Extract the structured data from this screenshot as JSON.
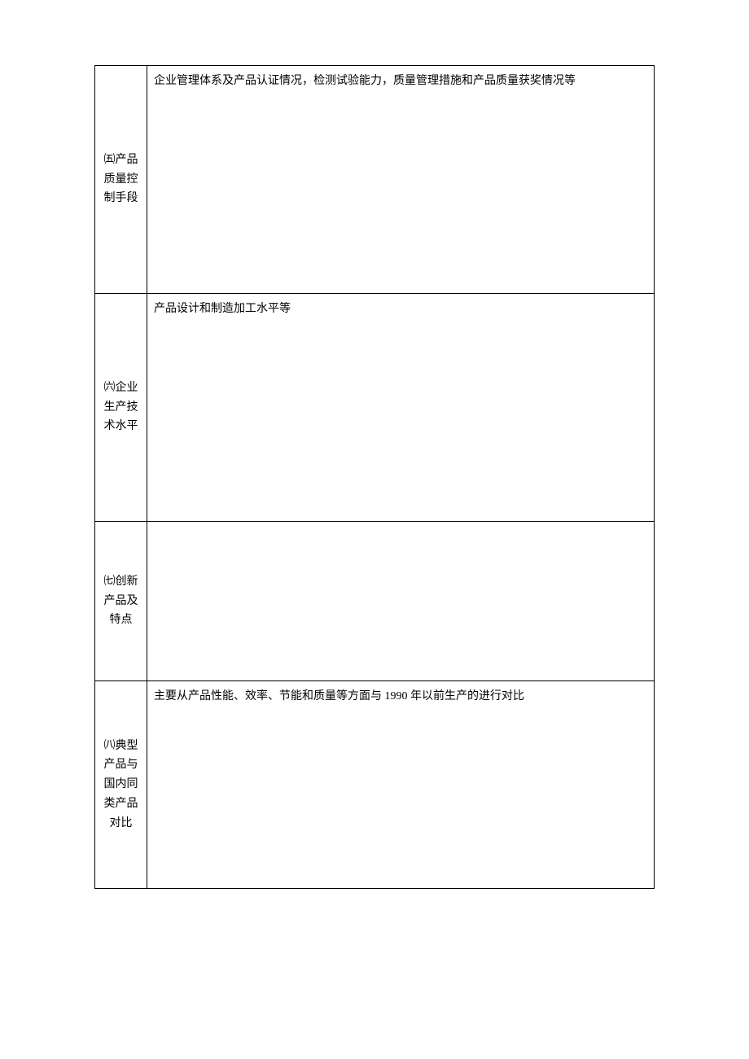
{
  "rows": [
    {
      "label": "㈤产品质量控制手段",
      "content": "企业管理体系及产品认证情况，检测试验能力，质量管理措施和产品质量获奖情况等"
    },
    {
      "label": "㈥企业生产技术水平",
      "content": "产品设计和制造加工水平等"
    },
    {
      "label": "㈦创新产品及特点",
      "content": ""
    },
    {
      "label": "㈧典型产品与国内同类产品对比",
      "content": "主要从产品性能、效率、节能和质量等方面与 1990 年以前生产的进行对比"
    }
  ]
}
